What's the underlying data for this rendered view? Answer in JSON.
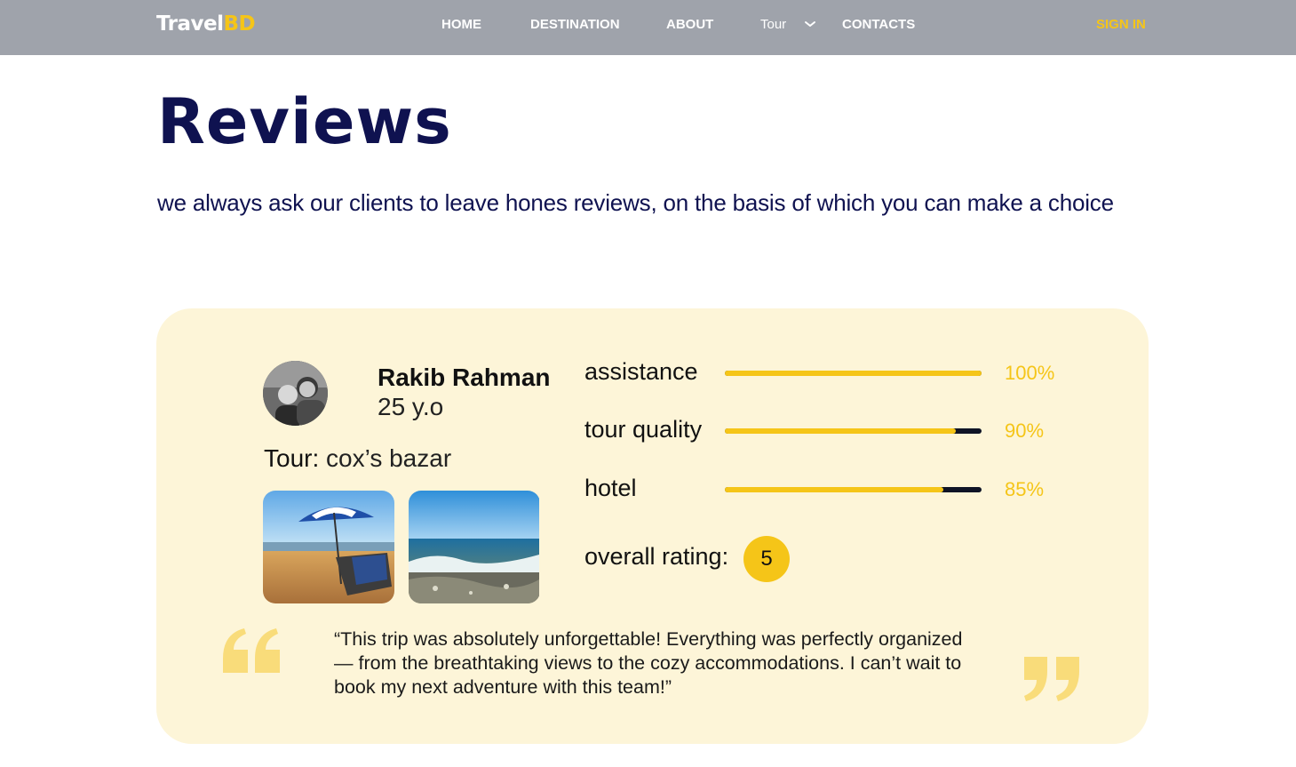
{
  "nav": {
    "logo_main": "Travel",
    "logo_accent": "BD",
    "links": [
      "HOME",
      "DESTINATION",
      "ABOUT",
      "Tour",
      "CONTACTS"
    ],
    "sign_in": "SIGN IN"
  },
  "header": {
    "title": "Reviews",
    "subtitle": "we always ask our clients to leave hones reviews, on the basis of which you can make a choice"
  },
  "review": {
    "name": "Rakib Rahman",
    "age": "25 y.o",
    "tour_label": "Tour:",
    "tour_value": "cox’s bazar",
    "ratings": [
      {
        "label": "assistance",
        "percent_text": "100%",
        "value": 1.0
      },
      {
        "label": "tour quality",
        "percent_text": "90%",
        "value": 0.9
      },
      {
        "label": "hotel",
        "percent_text": "85%",
        "value": 0.85
      }
    ],
    "overall_label": "overall rating:",
    "overall_value": "5",
    "quote": "“This trip was absolutely unforgettable! Everything was perfectly organized — from the breathtaking views to the cozy accommodations. I can’t wait to book my next adventure with this team!”"
  },
  "colors": {
    "navbar": "#9fa3ab",
    "accent": "#f5c518",
    "card": "#fdf5d8",
    "title": "#0f1250"
  }
}
